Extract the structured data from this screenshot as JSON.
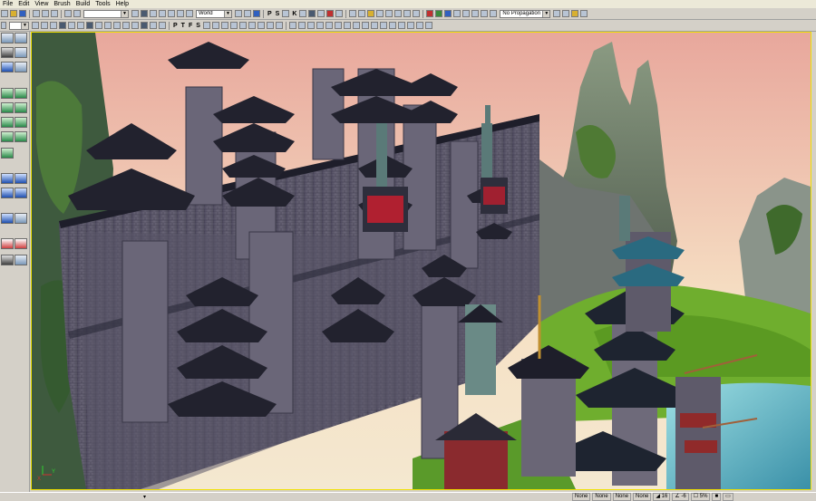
{
  "menu": [
    "File",
    "Edit",
    "View",
    "Brush",
    "Build",
    "Tools",
    "Help"
  ],
  "toolbar": {
    "coord_system": "World",
    "propagation": "No Propagation",
    "texture_labels": [
      "P",
      "S",
      "K"
    ],
    "text_tools": [
      "P",
      "T",
      "F",
      "S"
    ]
  },
  "status": {
    "fields": [
      "None",
      "None",
      "None",
      "None"
    ],
    "grid": "16",
    "angle": "-6",
    "zoom": "5%"
  },
  "viewport": {
    "axis_labels": [
      "Y",
      "X"
    ],
    "colors": {
      "sky_top": "#e8a79c",
      "sky_bottom": "#f6e0c4",
      "wall": "#5e5a6e",
      "roof": "#1a1a26",
      "grass": "#6fae2e",
      "water": "#6cc0c8",
      "selection_border": "#f0e000"
    }
  }
}
